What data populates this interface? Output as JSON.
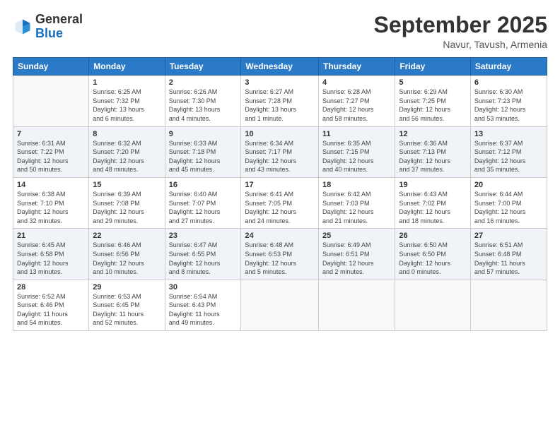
{
  "header": {
    "logo_general": "General",
    "logo_blue": "Blue",
    "month_title": "September 2025",
    "location": "Navur, Tavush, Armenia"
  },
  "days_of_week": [
    "Sunday",
    "Monday",
    "Tuesday",
    "Wednesday",
    "Thursday",
    "Friday",
    "Saturday"
  ],
  "weeks": [
    [
      {
        "day": "",
        "info": ""
      },
      {
        "day": "1",
        "info": "Sunrise: 6:25 AM\nSunset: 7:32 PM\nDaylight: 13 hours\nand 6 minutes."
      },
      {
        "day": "2",
        "info": "Sunrise: 6:26 AM\nSunset: 7:30 PM\nDaylight: 13 hours\nand 4 minutes."
      },
      {
        "day": "3",
        "info": "Sunrise: 6:27 AM\nSunset: 7:28 PM\nDaylight: 13 hours\nand 1 minute."
      },
      {
        "day": "4",
        "info": "Sunrise: 6:28 AM\nSunset: 7:27 PM\nDaylight: 12 hours\nand 58 minutes."
      },
      {
        "day": "5",
        "info": "Sunrise: 6:29 AM\nSunset: 7:25 PM\nDaylight: 12 hours\nand 56 minutes."
      },
      {
        "day": "6",
        "info": "Sunrise: 6:30 AM\nSunset: 7:23 PM\nDaylight: 12 hours\nand 53 minutes."
      }
    ],
    [
      {
        "day": "7",
        "info": "Sunrise: 6:31 AM\nSunset: 7:22 PM\nDaylight: 12 hours\nand 50 minutes."
      },
      {
        "day": "8",
        "info": "Sunrise: 6:32 AM\nSunset: 7:20 PM\nDaylight: 12 hours\nand 48 minutes."
      },
      {
        "day": "9",
        "info": "Sunrise: 6:33 AM\nSunset: 7:18 PM\nDaylight: 12 hours\nand 45 minutes."
      },
      {
        "day": "10",
        "info": "Sunrise: 6:34 AM\nSunset: 7:17 PM\nDaylight: 12 hours\nand 43 minutes."
      },
      {
        "day": "11",
        "info": "Sunrise: 6:35 AM\nSunset: 7:15 PM\nDaylight: 12 hours\nand 40 minutes."
      },
      {
        "day": "12",
        "info": "Sunrise: 6:36 AM\nSunset: 7:13 PM\nDaylight: 12 hours\nand 37 minutes."
      },
      {
        "day": "13",
        "info": "Sunrise: 6:37 AM\nSunset: 7:12 PM\nDaylight: 12 hours\nand 35 minutes."
      }
    ],
    [
      {
        "day": "14",
        "info": "Sunrise: 6:38 AM\nSunset: 7:10 PM\nDaylight: 12 hours\nand 32 minutes."
      },
      {
        "day": "15",
        "info": "Sunrise: 6:39 AM\nSunset: 7:08 PM\nDaylight: 12 hours\nand 29 minutes."
      },
      {
        "day": "16",
        "info": "Sunrise: 6:40 AM\nSunset: 7:07 PM\nDaylight: 12 hours\nand 27 minutes."
      },
      {
        "day": "17",
        "info": "Sunrise: 6:41 AM\nSunset: 7:05 PM\nDaylight: 12 hours\nand 24 minutes."
      },
      {
        "day": "18",
        "info": "Sunrise: 6:42 AM\nSunset: 7:03 PM\nDaylight: 12 hours\nand 21 minutes."
      },
      {
        "day": "19",
        "info": "Sunrise: 6:43 AM\nSunset: 7:02 PM\nDaylight: 12 hours\nand 18 minutes."
      },
      {
        "day": "20",
        "info": "Sunrise: 6:44 AM\nSunset: 7:00 PM\nDaylight: 12 hours\nand 16 minutes."
      }
    ],
    [
      {
        "day": "21",
        "info": "Sunrise: 6:45 AM\nSunset: 6:58 PM\nDaylight: 12 hours\nand 13 minutes."
      },
      {
        "day": "22",
        "info": "Sunrise: 6:46 AM\nSunset: 6:56 PM\nDaylight: 12 hours\nand 10 minutes."
      },
      {
        "day": "23",
        "info": "Sunrise: 6:47 AM\nSunset: 6:55 PM\nDaylight: 12 hours\nand 8 minutes."
      },
      {
        "day": "24",
        "info": "Sunrise: 6:48 AM\nSunset: 6:53 PM\nDaylight: 12 hours\nand 5 minutes."
      },
      {
        "day": "25",
        "info": "Sunrise: 6:49 AM\nSunset: 6:51 PM\nDaylight: 12 hours\nand 2 minutes."
      },
      {
        "day": "26",
        "info": "Sunrise: 6:50 AM\nSunset: 6:50 PM\nDaylight: 12 hours\nand 0 minutes."
      },
      {
        "day": "27",
        "info": "Sunrise: 6:51 AM\nSunset: 6:48 PM\nDaylight: 11 hours\nand 57 minutes."
      }
    ],
    [
      {
        "day": "28",
        "info": "Sunrise: 6:52 AM\nSunset: 6:46 PM\nDaylight: 11 hours\nand 54 minutes."
      },
      {
        "day": "29",
        "info": "Sunrise: 6:53 AM\nSunset: 6:45 PM\nDaylight: 11 hours\nand 52 minutes."
      },
      {
        "day": "30",
        "info": "Sunrise: 6:54 AM\nSunset: 6:43 PM\nDaylight: 11 hours\nand 49 minutes."
      },
      {
        "day": "",
        "info": ""
      },
      {
        "day": "",
        "info": ""
      },
      {
        "day": "",
        "info": ""
      },
      {
        "day": "",
        "info": ""
      }
    ]
  ]
}
